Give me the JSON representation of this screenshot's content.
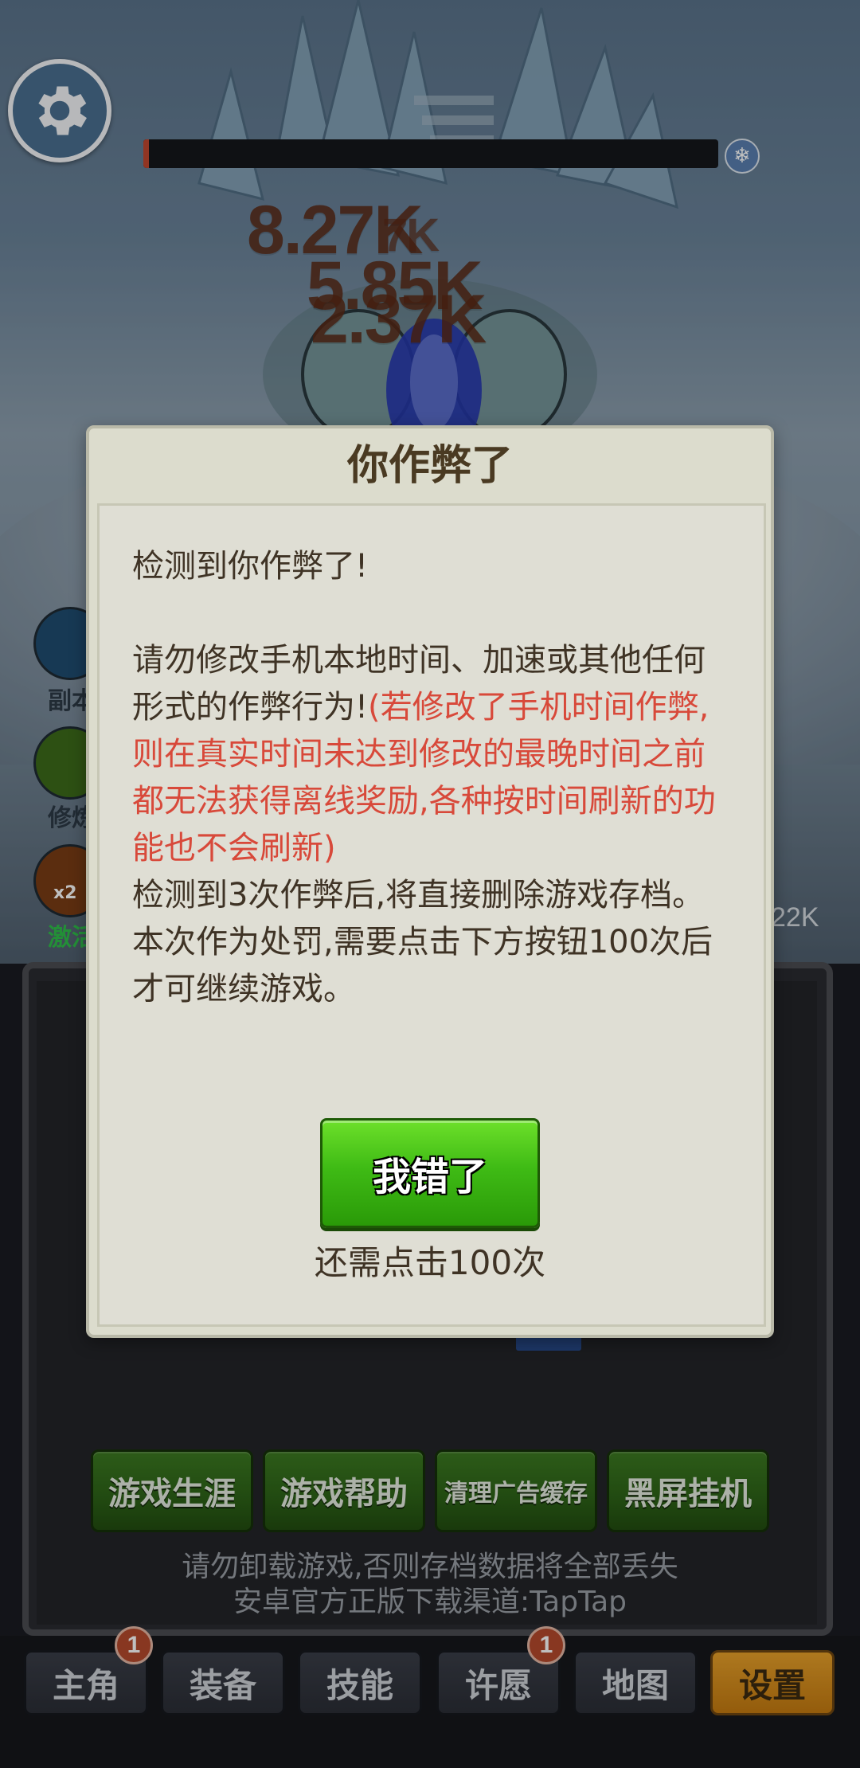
{
  "top": {
    "boss_hp_fraction": 0.01,
    "damage_numbers": [
      "8.27K",
      "7K",
      "5.85K",
      "2.37K"
    ]
  },
  "side_buttons": [
    {
      "label": "副本",
      "color": "#1f4d70"
    },
    {
      "label": "修炼",
      "color": "#3d6b1a"
    },
    {
      "label": "激活",
      "badge": "x2",
      "color": "#7a3d14",
      "label_color": "#2fbf4a"
    }
  ],
  "stat_text": "22K",
  "dialog": {
    "title": "你作弊了",
    "line1": "检测到你作弊了!",
    "para2_normal": "请勿修改手机本地时间、加速或其他任何形式的作弊行为!",
    "para2_warning": "(若修改了手机时间作弊,则在真实时间未达到修改的最晚时间之前都无法获得离线奖励,各种按时间刷新的功能也不会刷新)",
    "line3": "检测到3次作弊后,将直接删除游戏存档。",
    "line4": "本次作为处罚,需要点击下方按钮100次后才可继续游戏。",
    "button_label": "我错了",
    "remaining_label": "还需点击100次",
    "remaining_clicks": 100
  },
  "menu_buttons": [
    {
      "label": "游戏生涯"
    },
    {
      "label": "游戏帮助"
    },
    {
      "label": "清理广告缓存"
    },
    {
      "label": "黑屏挂机"
    }
  ],
  "notice": {
    "line1": "请勿卸载游戏,否则存档数据将全部丢失",
    "line2": "安卓官方正版下载渠道:TapTap"
  },
  "nav_tabs": [
    {
      "label": "主角",
      "badge": "1"
    },
    {
      "label": "装备"
    },
    {
      "label": "技能"
    },
    {
      "label": "许愿",
      "badge": "1"
    },
    {
      "label": "地图"
    },
    {
      "label": "设置",
      "active": true
    }
  ],
  "colors": {
    "dialog_bg": "#dcdccd",
    "warning_text": "#d8493a",
    "confirm_button": "#3fbb15",
    "active_tab": "#e8a12a",
    "badge": "#b64a2c"
  }
}
